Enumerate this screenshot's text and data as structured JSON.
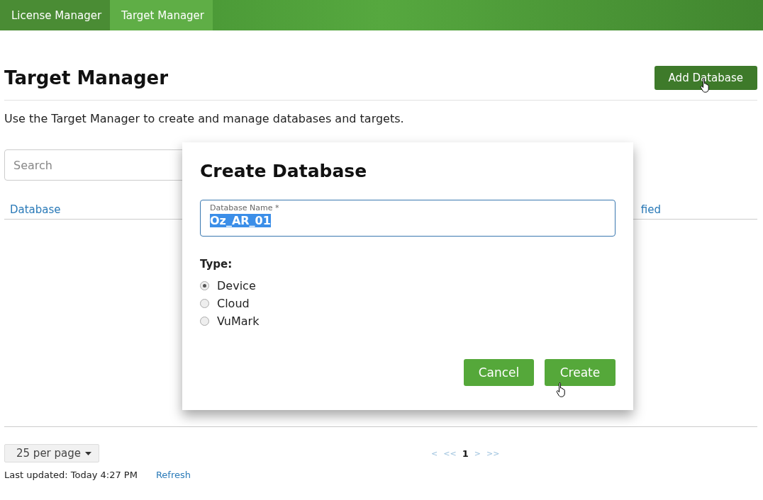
{
  "nav": {
    "tabs": [
      {
        "label": "License Manager",
        "selected": false
      },
      {
        "label": "Target Manager",
        "selected": true
      }
    ]
  },
  "page": {
    "title": "Target Manager",
    "add_button": "Add Database",
    "description": "Use the Target Manager to create and manage databases and targets.",
    "search": {
      "placeholder": "Search"
    },
    "table": {
      "columns": [
        "Database",
        "fied"
      ]
    }
  },
  "footer": {
    "per_page": "25 per page",
    "pager": [
      {
        "label": "<",
        "selected": false
      },
      {
        "label": "<<",
        "selected": false
      },
      {
        "label": "1",
        "selected": true
      },
      {
        "label": ">",
        "selected": false
      },
      {
        "label": ">>",
        "selected": false
      }
    ],
    "last_updated": "Last updated: Today 4:27 PM",
    "refresh": "Refresh"
  },
  "dialog": {
    "title": "Create Database",
    "name_field": {
      "label": "Database Name *",
      "value": "Oz_AR_01"
    },
    "type_label": "Type:",
    "types": [
      {
        "label": "Device",
        "selected": true
      },
      {
        "label": "Cloud",
        "selected": false
      },
      {
        "label": "VuMark",
        "selected": false
      }
    ],
    "buttons": [
      "Cancel",
      "Create"
    ]
  }
}
